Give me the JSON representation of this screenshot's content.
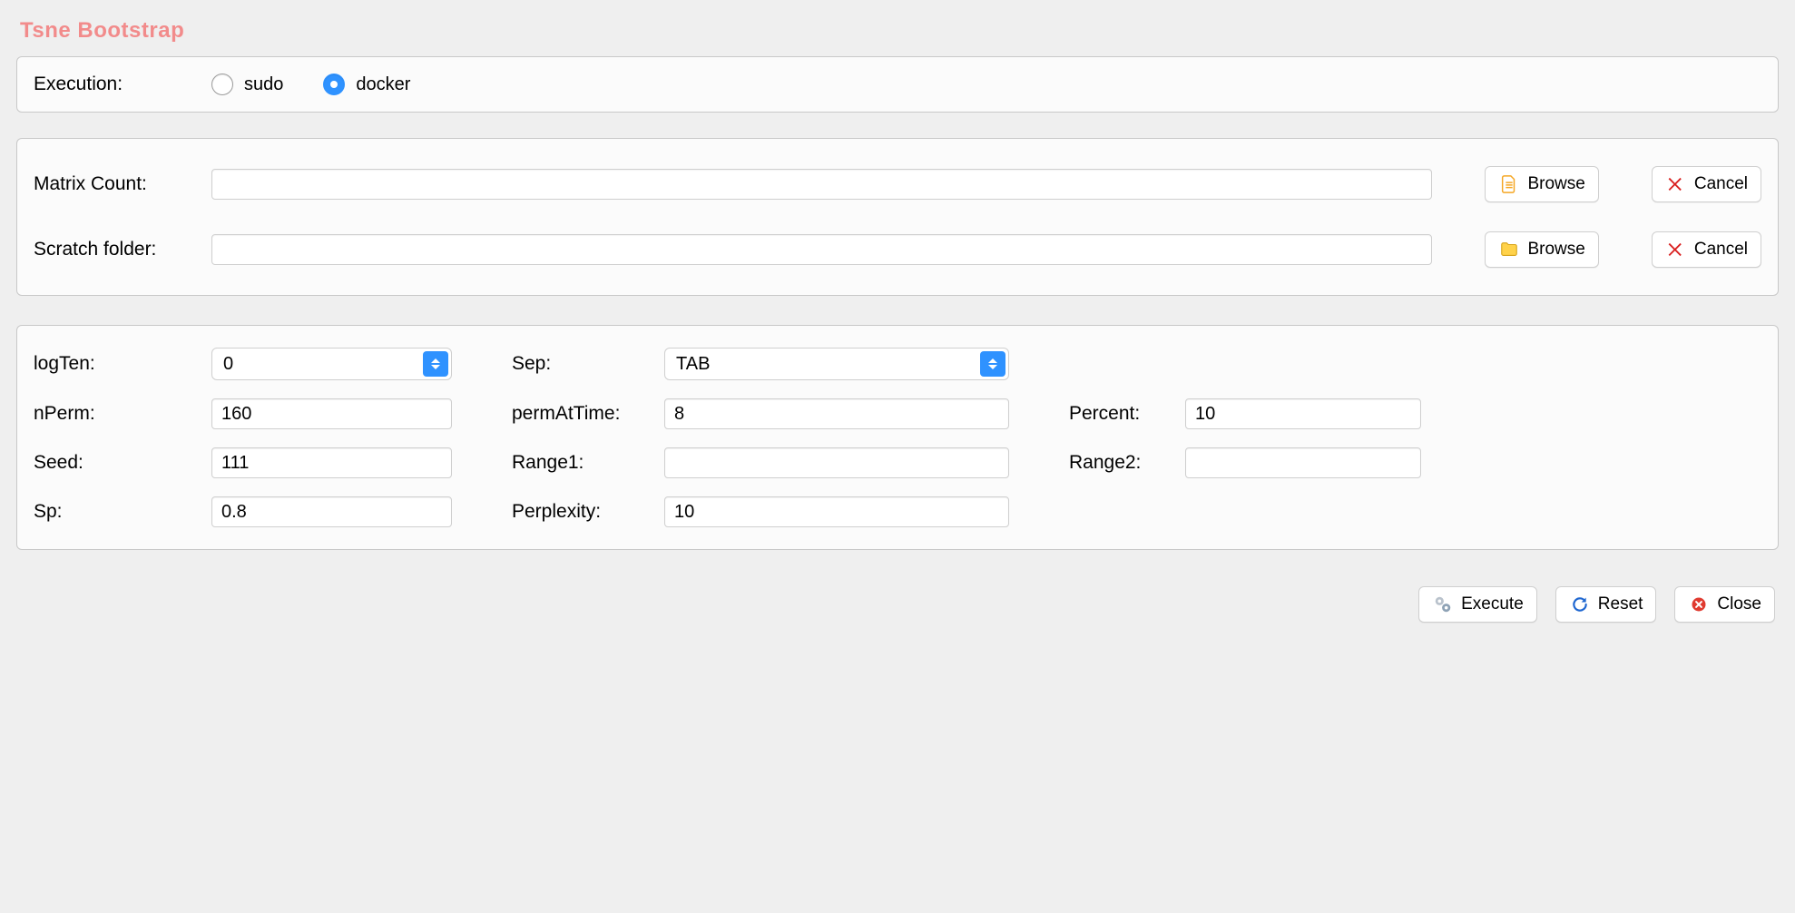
{
  "title": "Tsne Bootstrap",
  "execution": {
    "label": "Execution:",
    "options": [
      "sudo",
      "docker"
    ],
    "selected": "docker"
  },
  "files": {
    "matrix_label": "Matrix Count:",
    "matrix_value": "",
    "scratch_label": "Scratch folder:",
    "scratch_value": "",
    "browse_label": "Browse",
    "cancel_label": "Cancel"
  },
  "params": {
    "logten_label": "logTen:",
    "logten_value": "0",
    "sep_label": "Sep:",
    "sep_value": "TAB",
    "nperm_label": "nPerm:",
    "nperm_value": "160",
    "permattime_label": "permAtTime:",
    "permattime_value": "8",
    "percent_label": "Percent:",
    "percent_value": "10",
    "seed_label": "Seed:",
    "seed_value": "111",
    "range1_label": "Range1:",
    "range1_value": "",
    "range2_label": "Range2:",
    "range2_value": "",
    "sp_label": "Sp:",
    "sp_value": "0.8",
    "perplexity_label": "Perplexity:",
    "perplexity_value": "10"
  },
  "footer": {
    "execute_label": "Execute",
    "reset_label": "Reset",
    "close_label": "Close"
  }
}
